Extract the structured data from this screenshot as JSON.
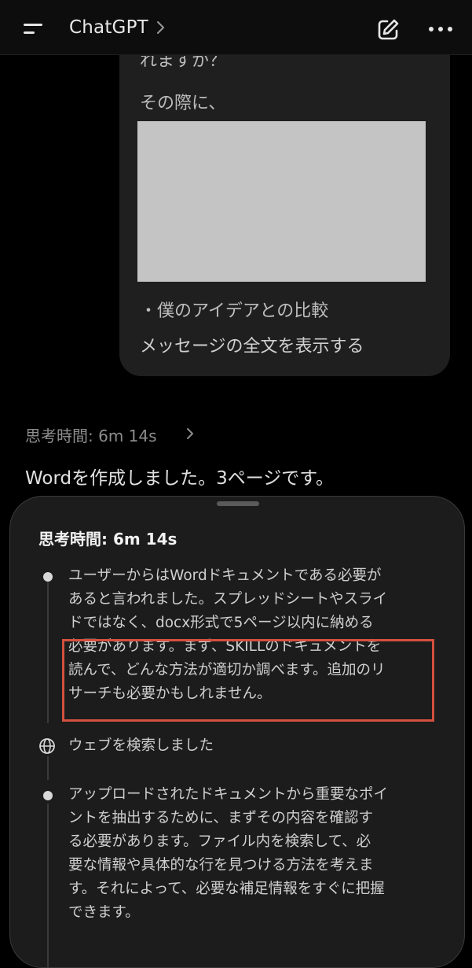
{
  "header": {
    "title": "ChatGPT",
    "title_chevron": ">",
    "menu_icon": "menu-icon",
    "edit_icon": "new-chat-icon",
    "more_icon": "more-icon"
  },
  "user_message": {
    "partial_top_line": "れますか？",
    "line_2": "その際に、",
    "bullet_line": "・僕のアイデアとの比較",
    "show_full_link": "メッセージの全文を表示する"
  },
  "assistant": {
    "thinking_summary": "思考時間: 6m 14s",
    "thinking_chevron": ">",
    "reply": "Wordを作成しました。3ページです。"
  },
  "sheet": {
    "title": "思考時間: 6m 14s",
    "steps": [
      {
        "type": "thought",
        "lines": [
          "ユーザーからはWordドキュメントである必要が",
          "あると言われました。スプレッドシートやスライ",
          "ドではなく、docx形式で5ページ以内に納める",
          "必要があります。まず、SKILLのドキュメントを",
          "読んで、どんな方法が適切か調べます。追加のリ",
          "サーチも必要かもしれません。"
        ]
      },
      {
        "type": "web_search",
        "icon": "globe-icon",
        "label": "ウェブを検索しました"
      },
      {
        "type": "thought",
        "lines": [
          "アップロードされたドキュメントから重要なポイ",
          "ントを抽出するために、まずその内容を確認す",
          "る必要があります。ファイル内を検索して、必",
          "要な情報や具体的な行を見つける方法を考えま",
          "す。それによって、必要な補足情報をすぐに把握",
          "できます。"
        ]
      }
    ]
  },
  "colors": {
    "background": "#000000",
    "bubble": "#1f1f1f",
    "sheet": "#1c1c1c",
    "highlight": "#d4503f",
    "redaction": "#c4c4c4"
  }
}
